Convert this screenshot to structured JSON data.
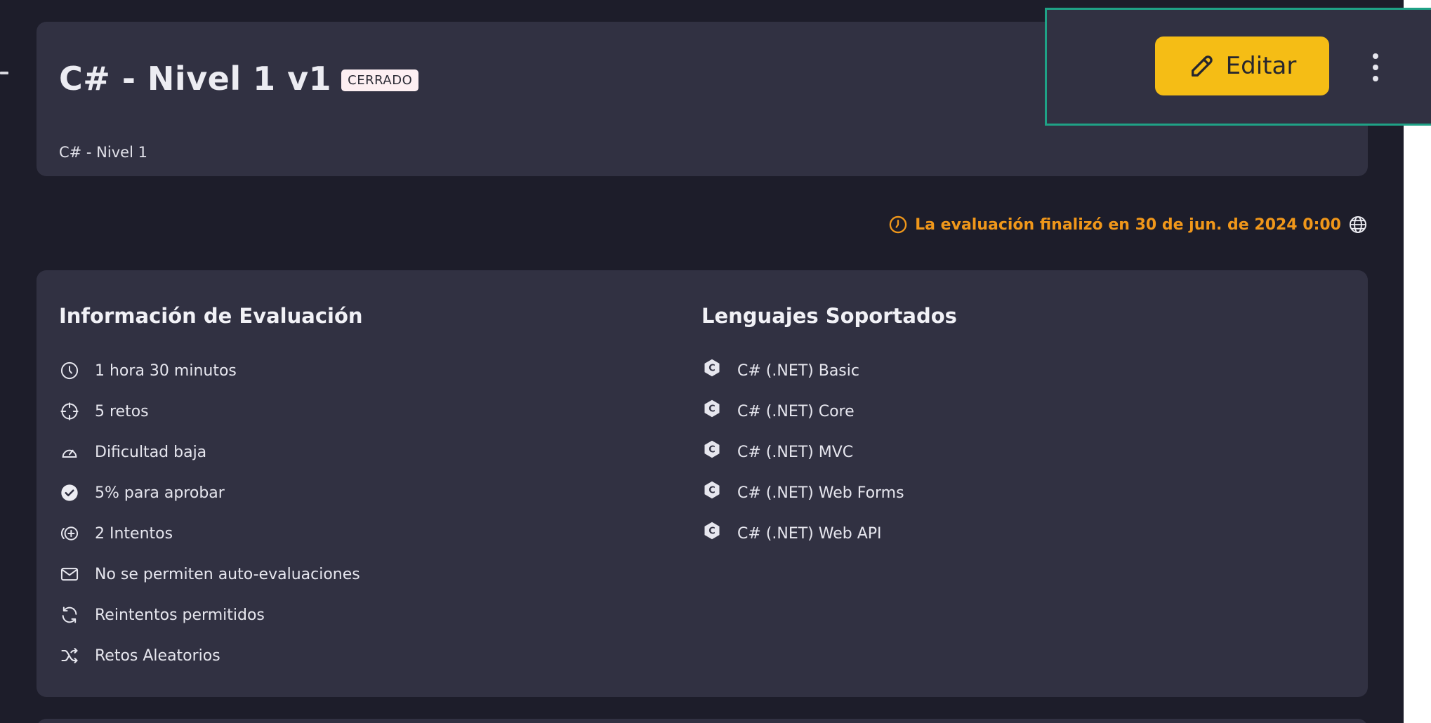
{
  "header": {
    "title": "C# - Nivel 1 v1",
    "status_badge": "CERRADO",
    "subtitle": "C# - Nivel 1"
  },
  "actions": {
    "edit_label": "Editar"
  },
  "deadline": {
    "text": "La evaluación finalizó en 30 de jun. de 2024 0:00",
    "color": "#f0971a"
  },
  "evaluation_info": {
    "title": "Información de Evaluación",
    "items": [
      {
        "icon": "clock-icon",
        "label": "1 hora 30 minutos"
      },
      {
        "icon": "crosshair-icon",
        "label": "5 retos"
      },
      {
        "icon": "gauge-icon",
        "label": "Dificultad baja"
      },
      {
        "icon": "check-circle-icon",
        "label": "5% para aprobar"
      },
      {
        "icon": "attempts-icon",
        "label": "2 Intentos"
      },
      {
        "icon": "mail-icon",
        "label": "No se permiten auto-evaluaciones"
      },
      {
        "icon": "refresh-icon",
        "label": "Reintentos permitidos"
      },
      {
        "icon": "shuffle-icon",
        "label": "Retos Aleatorios"
      }
    ]
  },
  "languages": {
    "title": "Lenguajes Soportados",
    "items": [
      {
        "icon": "csharp-icon",
        "label": "C# (.NET) Basic"
      },
      {
        "icon": "csharp-icon",
        "label": "C# (.NET) Core"
      },
      {
        "icon": "csharp-icon",
        "label": "C# (.NET) MVC"
      },
      {
        "icon": "csharp-icon",
        "label": "C# (.NET) Web Forms"
      },
      {
        "icon": "csharp-icon",
        "label": "C# (.NET) Web API"
      }
    ]
  },
  "colors": {
    "background": "#1d1d2a",
    "card": "#313142",
    "accent_button": "#f5bd15",
    "highlight_border": "#1fa286",
    "badge_bg": "#fdeff2"
  }
}
